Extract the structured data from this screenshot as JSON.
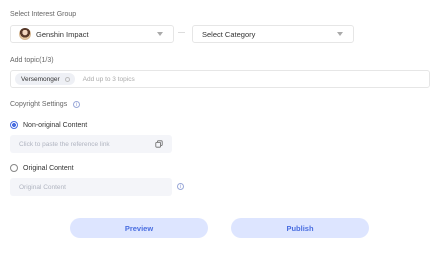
{
  "interest_group": {
    "label": "Select Interest Group",
    "group_value": "Genshin Impact",
    "separator": "—",
    "category_value": "Select Category"
  },
  "topics": {
    "label": "Add topic(1/3)",
    "tags": [
      "Versemonger"
    ],
    "placeholder": "Add up to 3 topics"
  },
  "copyright": {
    "label": "Copyright Settings",
    "non_original_label": "Non-original Content",
    "reference_placeholder": "Click to paste the reference link",
    "original_label": "Original Content",
    "original_placeholder": "Original Content",
    "selected": "non_original",
    "accent_color": "#4a6ee0"
  },
  "actions": {
    "preview_label": "Preview",
    "publish_label": "Publish",
    "button_bg": "#dde5ff"
  },
  "icons": {
    "info": "info-icon",
    "copy": "paste-link-icon",
    "dropdown": "chevron-down-icon",
    "remove_tag": "remove-tag-icon"
  }
}
